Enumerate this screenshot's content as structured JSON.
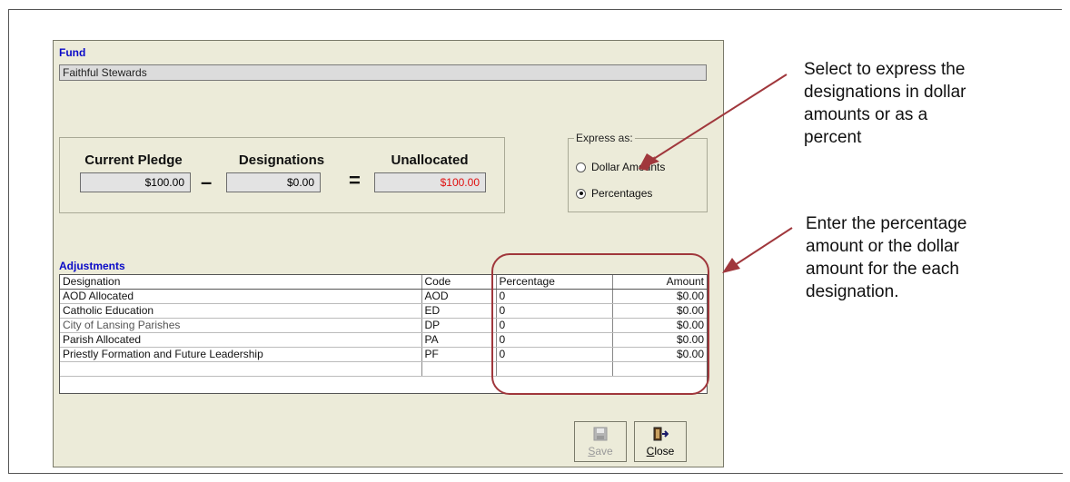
{
  "fund": {
    "label": "Fund",
    "value": "Faithful Stewards"
  },
  "calc": {
    "current_pledge": {
      "label": "Current Pledge",
      "value": "$100.00"
    },
    "minus": "–",
    "designations": {
      "label": "Designations",
      "value": "$0.00"
    },
    "equals": "=",
    "unallocated": {
      "label": "Unallocated",
      "value": "$100.00"
    }
  },
  "express": {
    "legend": "Express as:",
    "options": [
      {
        "label": "Dollar Amounts",
        "selected": false
      },
      {
        "label": "Percentages",
        "selected": true
      }
    ]
  },
  "adjustments": {
    "label": "Adjustments",
    "columns": [
      "Designation",
      "Code",
      "Percentage",
      "Amount"
    ],
    "rows": [
      {
        "designation": "AOD Allocated",
        "code": "AOD",
        "percentage": "0",
        "amount": "$0.00"
      },
      {
        "designation": "Catholic Education",
        "code": "ED",
        "percentage": "0",
        "amount": "$0.00"
      },
      {
        "designation": "City of Lansing Parishes",
        "code": "DP",
        "percentage": "0",
        "amount": "$0.00"
      },
      {
        "designation": "Parish Allocated",
        "code": "PA",
        "percentage": "0",
        "amount": "$0.00"
      },
      {
        "designation": "Priestly Formation and Future Leadership",
        "code": "PF",
        "percentage": "0",
        "amount": "$0.00"
      }
    ]
  },
  "buttons": {
    "save": {
      "label": "Save",
      "mnemonic": "S",
      "rest": "ave",
      "enabled": false
    },
    "close": {
      "label": "Close",
      "mnemonic": "C",
      "rest": "lose",
      "enabled": true
    }
  },
  "callouts": {
    "top": [
      "Select to express the",
      "designations in dollar",
      "amounts or as a",
      "percent"
    ],
    "bottom": [
      "Enter the percentage",
      "amount or the dollar",
      "amount for the each",
      "designation."
    ]
  },
  "colors": {
    "accent_blue": "#0a0ac8",
    "unallocated_red": "#e01010",
    "callout": "#a0373c",
    "window_bg": "#ecebd9"
  }
}
